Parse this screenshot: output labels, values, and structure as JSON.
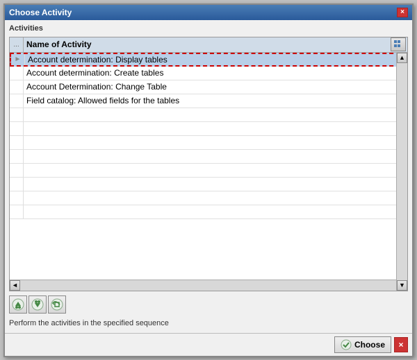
{
  "dialog": {
    "title": "Choose Activity",
    "close_label": "×"
  },
  "section": {
    "label": "Activities"
  },
  "table": {
    "col_header": "Name of Activity",
    "rows": [
      {
        "text": "Account determination: Display tables",
        "selected": true
      },
      {
        "text": "Account determination: Create tables",
        "selected": false
      },
      {
        "text": "Account Determination: Change Table",
        "selected": false
      },
      {
        "text": "Field catalog: Allowed fields for the tables",
        "selected": false
      },
      {
        "text": "",
        "selected": false
      },
      {
        "text": "",
        "selected": false
      },
      {
        "text": "",
        "selected": false
      },
      {
        "text": "",
        "selected": false
      },
      {
        "text": "",
        "selected": false
      },
      {
        "text": "",
        "selected": false
      },
      {
        "text": "",
        "selected": false
      },
      {
        "text": "",
        "selected": false
      }
    ]
  },
  "status": {
    "text": "Perform the activities in the specified sequence"
  },
  "footer": {
    "choose_label": "Choose",
    "cancel_label": "×"
  },
  "toolbar": {
    "btn1_title": "Move up",
    "btn2_title": "Move down",
    "btn3_title": "Reset"
  }
}
